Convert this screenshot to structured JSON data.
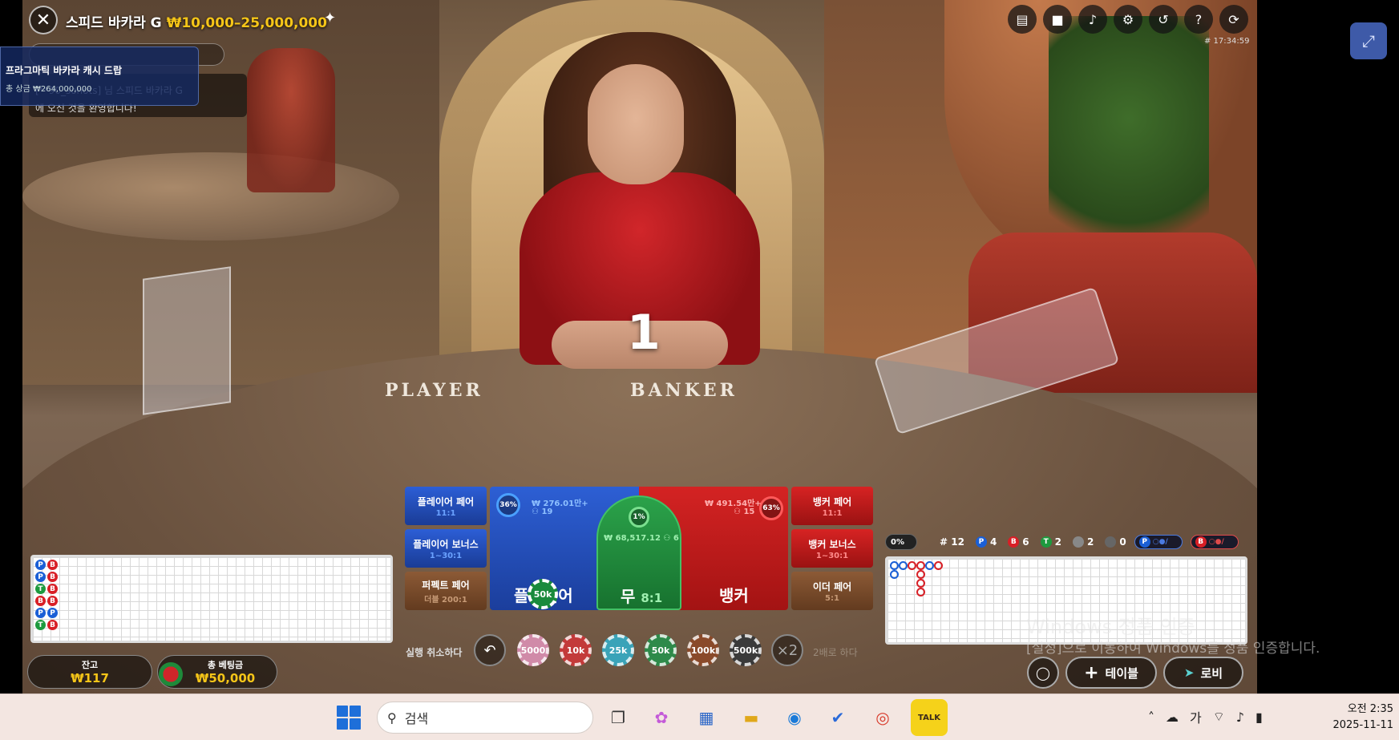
{
  "header": {
    "table_name": "스피드 바카라 G",
    "limits": "₩10,000–25,000,000",
    "clock_tag": "# 17:34:59"
  },
  "promo": {
    "title": "프라그마틱 바카라 캐시 드랍",
    "subtitle": "총 상금 ₩264,000,000"
  },
  "chat": {
    "message_line1": "[**90_sohots] 님 스피드 바카라 G",
    "message_line2": "에 오신 것을 환영합니다!"
  },
  "table_words": {
    "player": "PLAYER",
    "banker": "BANKER"
  },
  "countdown": "1",
  "side_bets": {
    "player_pair": {
      "label": "플레이어 페어",
      "odds": "11:1"
    },
    "player_bonus": {
      "label": "플레이어 보너스",
      "odds": "1~30:1"
    },
    "perfect_pair": {
      "label": "퍼펙트 페어",
      "odds": "더블 200:1"
    },
    "banker_pair": {
      "label": "뱅커 페어",
      "odds": "11:1"
    },
    "banker_bonus": {
      "label": "뱅커 보너스",
      "odds": "1~30:1"
    },
    "either_pair": {
      "label": "이더 페어",
      "odds": "5:1"
    }
  },
  "main_bets": {
    "player": {
      "label": "플레이어",
      "amount": "₩ 276.01만+",
      "players": "19",
      "percent": "36%"
    },
    "tie": {
      "label": "무",
      "odds": "8:1",
      "amount": "₩ 68,517.12",
      "players": "6",
      "percent": "1%"
    },
    "banker": {
      "label": "뱅커",
      "amount": "₩ 491.54만+",
      "players": "15",
      "percent": "63%"
    },
    "placed_chip": "50k"
  },
  "chips": {
    "undo_label": "실행 취소하다",
    "values": [
      "5000",
      "10k",
      "25k",
      "50k",
      "100k",
      "500k"
    ],
    "colors": [
      "#d08aa8",
      "#c33a3a",
      "#3aa3b8",
      "#2e8a4a",
      "#8a4a2a",
      "#3a3a3a"
    ],
    "double_button": "×2",
    "double_label": "2배로 하다"
  },
  "balance": {
    "label": "잔고",
    "value": "₩117"
  },
  "total_bet": {
    "label": "총 베팅금",
    "value": "₩50,000"
  },
  "stats": {
    "percent": "0%",
    "round": "# 12",
    "player_count": "4",
    "banker_count": "6",
    "tie_count": "2",
    "player_pair_count": "2",
    "banker_pair_count": "0",
    "player_predict": "P",
    "banker_predict": "B",
    "letter_p": "P",
    "letter_b": "B",
    "letter_t": "T"
  },
  "bead_road": [
    [
      "P",
      "B"
    ],
    [
      "P",
      "B"
    ],
    [
      "T",
      "B"
    ],
    [
      "B",
      "B"
    ],
    [
      "P",
      "P"
    ],
    [
      "T",
      "B"
    ]
  ],
  "bottom_buttons": {
    "table": "테이블",
    "lobby": "로비"
  },
  "watermark": {
    "title": "Windows 정품 인증",
    "subtitle": "[설정]으로 이동하여 Windows를 정품 인증합니다."
  },
  "taskbar": {
    "search_placeholder": "검색",
    "ime_label": "가",
    "time": "오전 2:35",
    "date": "2025-11-11",
    "kakao_label": "TALK"
  }
}
